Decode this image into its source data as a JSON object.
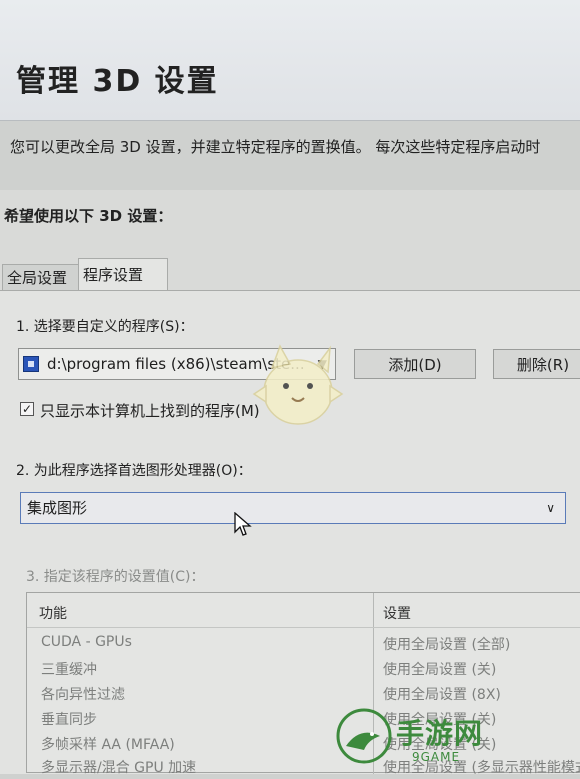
{
  "page": {
    "title": "管理 3D 设置",
    "description": "您可以更改全局 3D 设置，并建立特定程序的置换值。 每次这些特定程序启动时",
    "subtitle": "希望使用以下 3D 设置："
  },
  "tabs": [
    {
      "label": "全局设置",
      "active": false
    },
    {
      "label": "程序设置",
      "active": true
    }
  ],
  "program_section": {
    "label": "1. 选择要自定义的程序(S)：",
    "selected_program": "d:\\program files (x86)\\steam\\ste...",
    "add_button": "添加(D)",
    "delete_button": "删除(R)",
    "checkbox_label": "只显示本计算机上找到的程序(M)",
    "checkbox_checked": true
  },
  "gpu_section": {
    "label": "2. 为此程序选择首选图形处理器(O)：",
    "selected": "集成图形"
  },
  "settings_section": {
    "label": "3. 指定该程序的设置值(C)：",
    "columns": [
      "功能",
      "设置"
    ],
    "rows": [
      {
        "feature": "CUDA - GPUs",
        "setting": "使用全局设置 (全部)"
      },
      {
        "feature": "三重缓冲",
        "setting": "使用全局设置 (关)"
      },
      {
        "feature": "各向异性过滤",
        "setting": "使用全局设置 (8X)"
      },
      {
        "feature": "垂直同步",
        "setting": "使用全局设置 (关)"
      },
      {
        "feature": "多帧采样 AA (MFAA)",
        "setting": "使用全局设置 (关)"
      },
      {
        "feature": "多显示器/混合 GPU 加速",
        "setting": "使用全局设置 (多显示器性能模式)"
      }
    ]
  },
  "watermark": {
    "text": "手游网",
    "sub": "9GAME"
  },
  "colors": {
    "header_bg": "#e5e8eb",
    "content_bg": "#e2e3e1",
    "accent_border": "#5a7bb8",
    "watermark_green": "#3d8a3d"
  }
}
